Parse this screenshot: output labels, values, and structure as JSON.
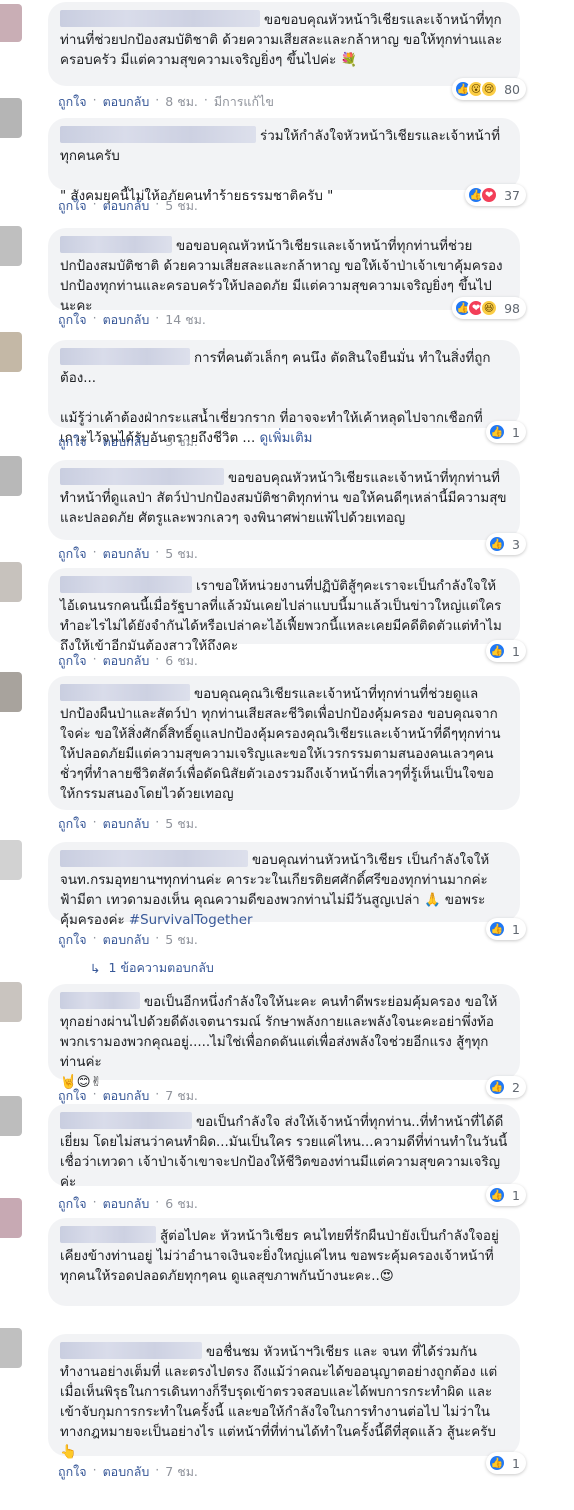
{
  "actions": {
    "like": "ถูกใจ",
    "reply": "ตอบกลับ",
    "separator": "·"
  },
  "comments": [
    {
      "text": "ขอขอบคุณหัวหน้าวิเชียรและเจ้าหน้าที่ทุกท่านที่ช่วยปกป้องสมบัติชาติ ด้วยความเสียสละและกล้าหาญ ขอให้ทุกท่านและครอบครัว มีแต่ความสุขความเจริญยิ่งๆ ขึ้นไปค่ะ 💐",
      "time": "8 ชม.",
      "edited": "มีการแก้ไข",
      "reactions": [
        "like",
        "wow",
        "sad"
      ],
      "count": "80",
      "avatar_color": "#c9aeb5"
    },
    {
      "text": "ร่วมให้กำลังใจหัวหน้าวิเชียรและเจ้าหน้าที่ทุกคนครับ\n\n\" สังคมยุคนี้ไม่ให้อภัยคนทำร้ายธรรมชาติครับ \"",
      "time": "5 ชม.",
      "reactions": [
        "like",
        "love"
      ],
      "count": "37",
      "avatar_color": "#b5b5b5"
    },
    {
      "text": "ขอขอบคุณหัวหน้าวิเชียรและเจ้าหน้าที่ทุกท่านที่ช่วยปกป้องสมบัติชาติ ด้วยความเสียสละและกล้าหาญ ขอให้เจ้าป่าเจ้าเขาคุ้มครองปกป้องทุกท่านและครอบครัวให้ปลอดภัย มีแต่ความสุขความเจริญยิ่งๆ ขึ้นไปนะคะ",
      "time": "14 ชม.",
      "reactions": [
        "like",
        "love",
        "haha"
      ],
      "count": "98",
      "avatar_color": "#bfbfbf"
    },
    {
      "text": "การที่คนตัวเล็กๆ คนนึง ตัดสินใจยืนมั่น ทำในสิ่งที่ถูกต้อง...\n\nแม้รู้ว่าเค้าต้องฝ่ากระแสน้ำเชี่ยวกราก ที่อาจจะทำให้เค้าหลุดไปจากเชือกที่เกาะไว้จนได้รับอันตรายถึงชีวิต ... ",
      "more": "ดูเพิ่มเติม",
      "time": "3 ชม.",
      "reactions": [
        "like"
      ],
      "count": "1",
      "avatar_color": "#c4b8a6"
    },
    {
      "text": "ขอขอบคุณหัวหน้าวิเชียรและเจ้าหน้าที่ทุกท่านที่ทำหน้าที่ดูแลป่า สัตว์ป่าปกป้องสมบัติชาติทุกท่าน ขอให้คนดีๆเหล่านี้มีความสุข และปลอดภัย ศัตรูและพวกเลวๆ จงพินาศพ่ายแพ้ไปด้วยเทอญ",
      "time": "5 ชม.",
      "reactions": [
        "like"
      ],
      "count": "3",
      "avatar_color": "#b8b8b8"
    },
    {
      "text": "เราขอให้หน่วยงานที่ปฏิบัติสู้ๆคะเราจะเป็นกำลังใจให้ไอ้เดนนรกคนนี้เมื่อรัฐบาลที่แล้วมันเคยไปล่าแบบนี้มาแล้วเป็นข่าวใหญ่แต่ใครทำอะไรไม่ได้ยังจำกันได้หรือเปล่าคะไอ้เฟี้ยพวกนี้แหละเคยมีคดีติดตัวแต่ทำไมถึงให้เข้าอีกมันต้องสาวให้ถึงคะ",
      "time": "6 ชม.",
      "reactions": [
        "like"
      ],
      "count": "1",
      "avatar_color": "#c7c2bd"
    },
    {
      "text": "ขอบคุณคุณวิเชียรและเจ้าหน้าที่ทุกท่านที่ช่วยดูแลปกป้องผืนป่าและสัตว์ป่า ทุกท่านเสียสละชีวิตเพื่อปกป้องคุ้มครอง ขอบคุณจากใจค่ะ ขอให้สิ่งศักดิ์สิทธิ์ดูแลปกป้องคุ้มครองคุณวิเชียรและเจ้าหน้าที่ดีๆทุกท่านให้ปลอดภัยมีแต่ความสุขความเจริญและขอให้เวรกรรมตามสนองคนเลวๆคนชั่วๆที่ทำลายชีวิตสัตว์เพื่อดัดนิสัยตัวเองรวมถึงเจ้าหน้าที่เลวๆที่รู้เห็นเป็นใจขอให้กรรมสนองโดยไวด้วยเทอญ",
      "time": "5 ชม.",
      "reactions": [],
      "count": "",
      "avatar_color": "#a8a39d"
    },
    {
      "text": "ขอบคุณท่านหัวหน้าวิเชียร เป็นกำลังใจให้ จนท.กรมอุทยานฯทุกท่านค่ะ คาระวะในเกียรติยศศักดิ์ศรีของทุกท่านมากค่ะ ฟ้ามีตา เทวดามองเห็น คุณความดีของพวกท่านไม่มีวันสูญเปล่า 🙏 ขอพระคุ้มครองค่ะ ",
      "hashtag": "#SurvivalTogether",
      "time": "5 ชม.",
      "reactions": [
        "like"
      ],
      "count": "1",
      "avatar_color": "#d2d2d2"
    },
    {
      "text": "ขอเป็นอีกหนึ่งกำลังใจให้นะคะ คนทำดีพระย่อมคุ้มครอง ขอให้ทุกอย่างผ่านไปด้วยดีดังเจตนารมณ์ รักษาพลังกายและพลังใจนะคะอย่าพึ่งท้อ พวกเรามองพวกคุณอยู่.....ไม่ใช่เพื่อกดดันแต่เพื่อส่งพลังใจช่วยอีกแรง สู้ๆทุกท่านค่ะ\n🤘😊✌",
      "time": "7 ชม.",
      "reactions": [
        "like"
      ],
      "count": "2",
      "avatar_color": "#c9c4bf"
    },
    {
      "text": "ขอเป็นกำลังใจ ส่งให้เจ้าหน้าที่ทุกท่าน..ที่ทำหน้าที่ได้ดีเยี่ยม โดยไม่สนว่าคนทำผิด...มันเป็นใคร รวยแค่ไหน...ความดีที่ท่านทำในวันนี้ เชื่อว่าเทวดา เจ้าป่าเจ้าเขาจะปกป้องให้ชีวิตของท่านมีแต่ความสุขความเจริญค่ะ",
      "time": "6 ชม.",
      "reactions": [
        "like"
      ],
      "count": "1",
      "avatar_color": "#bdbdbd"
    },
    {
      "text": "สู้ต่อไปคะ หัวหน้าวิเชียร คนไทยที่รักผืนป่ายังเป็นกำลังใจอยู่เคียงข้างท่านอยู่ ไม่ว่าอำนาจเงินจะยิ่งใหญ่แค่ไหน ขอพระคุ้มครองเจ้าหน้าที่ทุกคนให้รอดปลอดภัยทุกๆคน ดูแลสุขภาพกันบ้างนะคะ..😍",
      "time": "",
      "reactions": [],
      "count": "",
      "avatar_color": "#c7a9b3"
    },
    {
      "text": "ขอชื่นชม หัวหน้าฯวิเชียร และ จนท ที่ได้ร่วมกันทำงานอย่างเต็มที่ และตรงไปตรง ถึงแม้ว่าคณะได้ขออนุญาตอย่างถูกต้อง แต่เมื่อเห็นพิรุธในการเดินทางก็รีบรุดเข้าตรวจสอบและได้พบการกระทำผิด และเข้าจับกุมการกระทำในครั้งนี้ และขอให้กำลังใจในการทำงานต่อไป ไม่ว่าในทางกฎหมายจะเป็นอย่างไร แต่หน้าที่ที่ท่านได้ทำในครั้งนี้ดีที่สุดแล้ว สู้นะครับ👆",
      "time": "7 ชม.",
      "reactions": [
        "like"
      ],
      "count": "1",
      "avatar_color": "#c0c0c0"
    }
  ],
  "replies_link": "1 ข้อความตอบกลับ",
  "replies_icon": "reply-arrow-icon"
}
